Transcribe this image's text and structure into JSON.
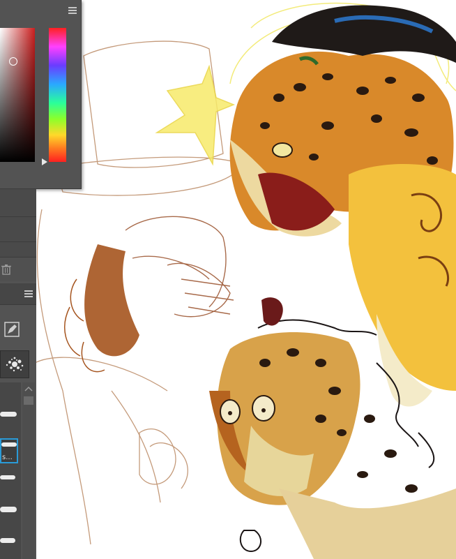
{
  "canvas": {
    "background": "#ffffff",
    "artwork_icon": "jaguar-sketch-artwork"
  },
  "color_panel": {
    "menu_icon": "panel-menu-icon",
    "selected_color": "#7a1d1d"
  },
  "layers_panel": {
    "delete_icon": "trash-icon"
  },
  "brushes_panel": {
    "menu_icon": "panel-menu-icon",
    "brush_settings_icon": "brush-pen-icon",
    "selected_brush_label": "s...",
    "scroll_up_icon": "scroll-up-icon"
  }
}
